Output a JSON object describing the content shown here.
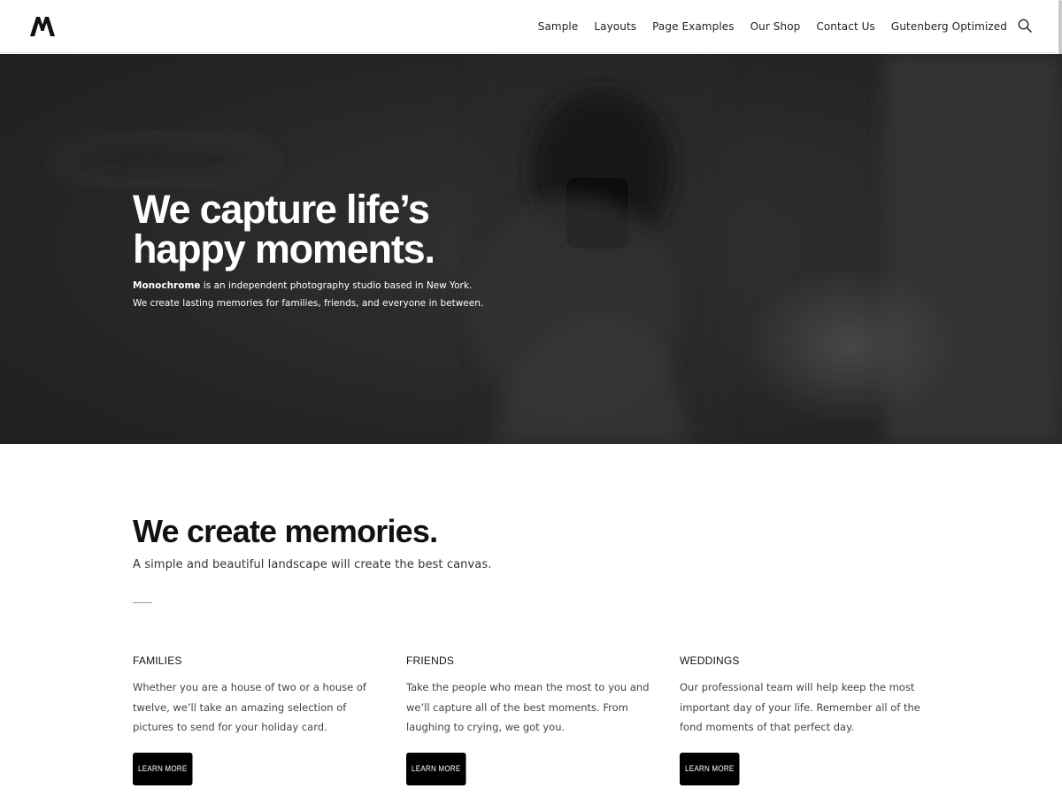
{
  "header": {
    "logo_alt": "M",
    "nav": [
      "Sample",
      "Layouts",
      "Page Examples",
      "Our Shop",
      "Contact Us",
      "Gutenberg Optimized"
    ],
    "search_icon": "search-icon"
  },
  "hero": {
    "title_line1": "We capture life’s",
    "title_line2": "happy moments.",
    "sub_brand": "Monochrome",
    "sub_line1_rest": " is an independent photography studio based in New York.",
    "sub_line2": "We create lasting memories for families, friends, and everyone in between."
  },
  "section": {
    "title": "We create memories.",
    "subtitle": "A simple and beautiful landscape will create the best canvas."
  },
  "features": [
    {
      "heading": "FAMILIES",
      "text": "Whether you are a house of two or a house of twelve, we’ll take an amazing selection of pictures to send for your holiday card.",
      "button": "LEARN MORE"
    },
    {
      "heading": "FRIENDS",
      "text": "Take the people who mean the most to you and we’ll capture all of the best moments. From laughing to crying, we got you.",
      "button": "LEARN MORE"
    },
    {
      "heading": "WEDDINGS",
      "text": "Our professional team will help keep the most important day of your life. Remember all of the fond moments of that perfect day.",
      "button": "LEARN MORE"
    }
  ],
  "colors": {
    "header_bg": "#ffffff",
    "hero_overlay": "#2a2a2a",
    "button_bg": "#000000",
    "text": "#111111"
  }
}
